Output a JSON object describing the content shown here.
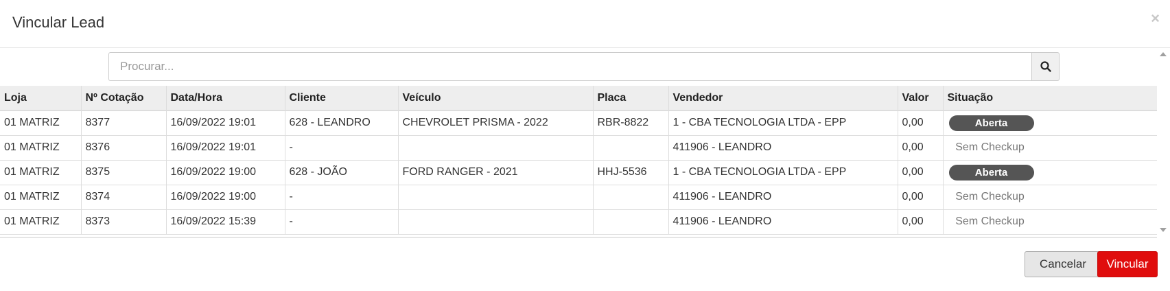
{
  "modal": {
    "title": "Vincular Lead",
    "close_glyph": "×"
  },
  "search": {
    "placeholder": "Procurar...",
    "value": "",
    "button_icon": "search-icon"
  },
  "table": {
    "columns": [
      "Loja",
      "Nº Cotação",
      "Data/Hora",
      "Cliente",
      "Veículo",
      "Placa",
      "Vendedor",
      "Valor",
      "Situação"
    ],
    "rows": [
      {
        "loja": "01 MATRIZ",
        "cotacao": "8377",
        "data_hora": "16/09/2022 19:01",
        "cliente": "628 - LEANDRO",
        "veiculo": "CHEVROLET PRISMA - 2022",
        "placa": "RBR-8822",
        "vendedor": "1 - CBA TECNOLOGIA LTDA - EPP",
        "valor": "0,00",
        "situacao": "Aberta"
      },
      {
        "loja": "01 MATRIZ",
        "cotacao": "8376",
        "data_hora": "16/09/2022 19:01",
        "cliente": "-",
        "veiculo": "",
        "placa": "",
        "vendedor": "411906 - LEANDRO",
        "valor": "0,00",
        "situacao": "Sem Checkup"
      },
      {
        "loja": "01 MATRIZ",
        "cotacao": "8375",
        "data_hora": "16/09/2022 19:00",
        "cliente": "628 - JOÃO",
        "veiculo": "FORD RANGER - 2021",
        "placa": "HHJ-5536",
        "vendedor": "1 - CBA TECNOLOGIA LTDA - EPP",
        "valor": "0,00",
        "situacao": "Aberta"
      },
      {
        "loja": "01 MATRIZ",
        "cotacao": "8374",
        "data_hora": "16/09/2022 19:00",
        "cliente": "-",
        "veiculo": "",
        "placa": "",
        "vendedor": "411906 - LEANDRO",
        "valor": "0,00",
        "situacao": "Sem Checkup"
      },
      {
        "loja": "01 MATRIZ",
        "cotacao": "8373",
        "data_hora": "16/09/2022 15:39",
        "cliente": "-",
        "veiculo": "",
        "placa": "",
        "vendedor": "411906 - LEANDRO",
        "valor": "0,00",
        "situacao": "Sem Checkup"
      }
    ]
  },
  "footer": {
    "cancel_label": "Cancelar",
    "confirm_label": "Vincular"
  },
  "colors": {
    "accent_red": "#e00d0d",
    "badge_dark": "#555555",
    "header_bg": "#eeeeee"
  }
}
